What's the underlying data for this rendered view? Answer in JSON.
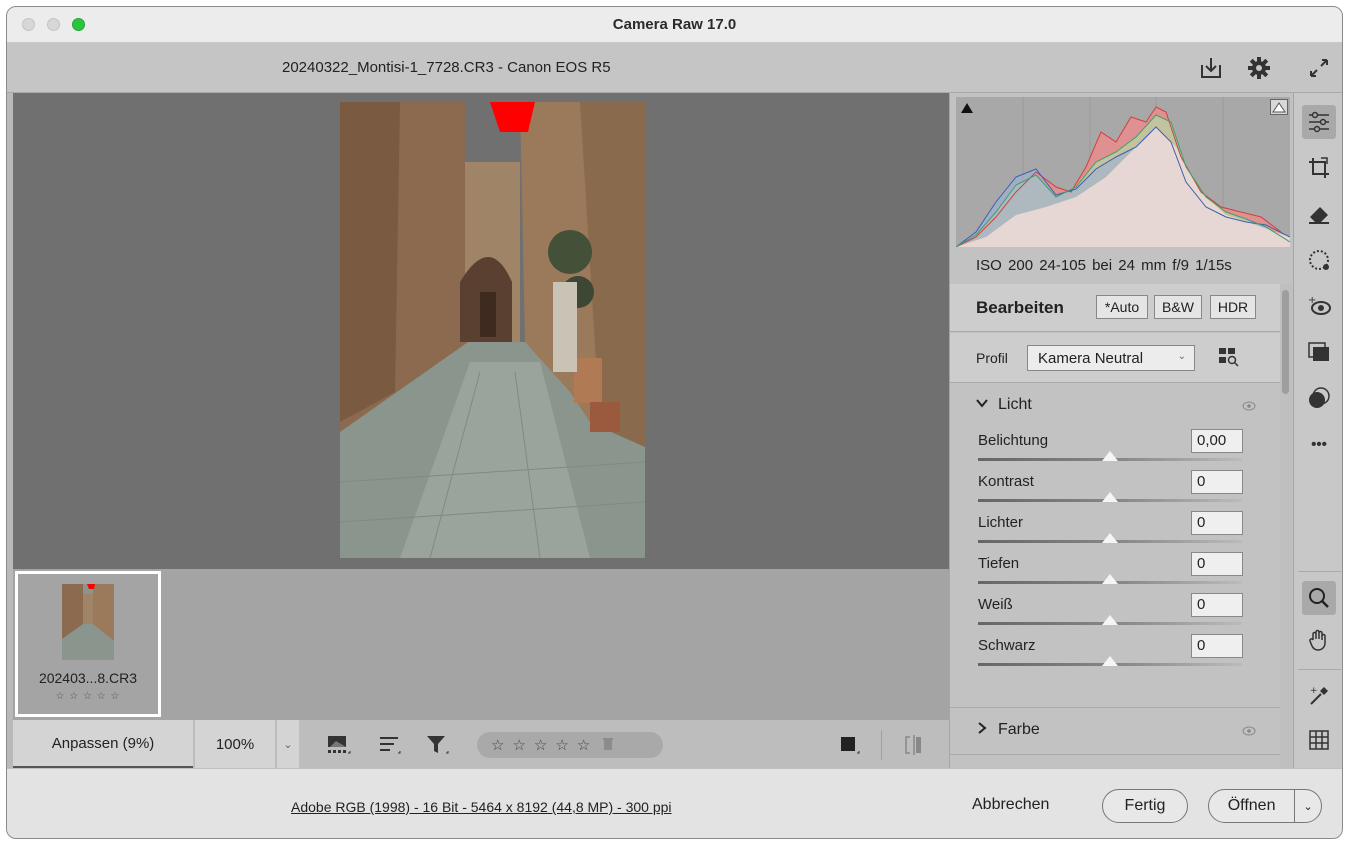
{
  "window": {
    "title": "Camera Raw 17.0"
  },
  "header": {
    "file_title": "20240322_Montisi-1_7728.CR3 - Canon EOS R5",
    "icons": [
      "save-download-icon",
      "gear-icon",
      "fullscreen-icon"
    ]
  },
  "filmstrip": {
    "items": [
      {
        "name": "202403...8.CR3",
        "stars": "☆ ☆ ☆ ☆ ☆"
      }
    ]
  },
  "toolbar": {
    "fit_label": "Anpassen (9%)",
    "zoom_label": "100%",
    "zoom_chevron": "⌄",
    "rating_stars": [
      "☆",
      "☆",
      "☆",
      "☆",
      "☆"
    ],
    "trash_glyph": "🗑"
  },
  "status": {
    "image_info": "Adobe RGB (1998) - 16 Bit - 5464 x 8192 (44,8 MP) - 300 ppi",
    "cancel_label": "Abbrechen",
    "done_label": "Fertig",
    "open_label": "Öffnen",
    "open_chevron": "⌄"
  },
  "histogram": {
    "exif": "ISO 200   24-105 bei 24 mm   f/9   1/15s"
  },
  "edit": {
    "title": "Bearbeiten",
    "auto_label": "*Auto",
    "bw_label": "B&W",
    "hdr_label": "HDR",
    "profile_label": "Profil",
    "profile_value": "Kamera Neutral",
    "profile_chevron": "⌄"
  },
  "light": {
    "title": "Licht",
    "chevron": "⌄",
    "sliders": [
      {
        "label": "Belichtung",
        "value": "0,00"
      },
      {
        "label": "Kontrast",
        "value": "0"
      },
      {
        "label": "Lichter",
        "value": "0"
      },
      {
        "label": "Tiefen",
        "value": "0"
      },
      {
        "label": "Weiß",
        "value": "0"
      },
      {
        "label": "Schwarz",
        "value": "0"
      }
    ]
  },
  "color_section": {
    "title": "Farbe",
    "chevron": "›"
  },
  "tool_rail": {
    "tools": [
      "edit-sliders-icon",
      "crop-icon",
      "eraser-icon",
      "masking-icon",
      "red-eye-icon",
      "presets-icon",
      "snapshots-icon",
      "more-icon",
      "zoom-icon",
      "hand-icon",
      "color-sampler-icon",
      "grid-icon"
    ],
    "more_glyph": "•••"
  },
  "colors": {
    "accent_green": "#2bc440",
    "clipping_red": "#ff0000"
  }
}
